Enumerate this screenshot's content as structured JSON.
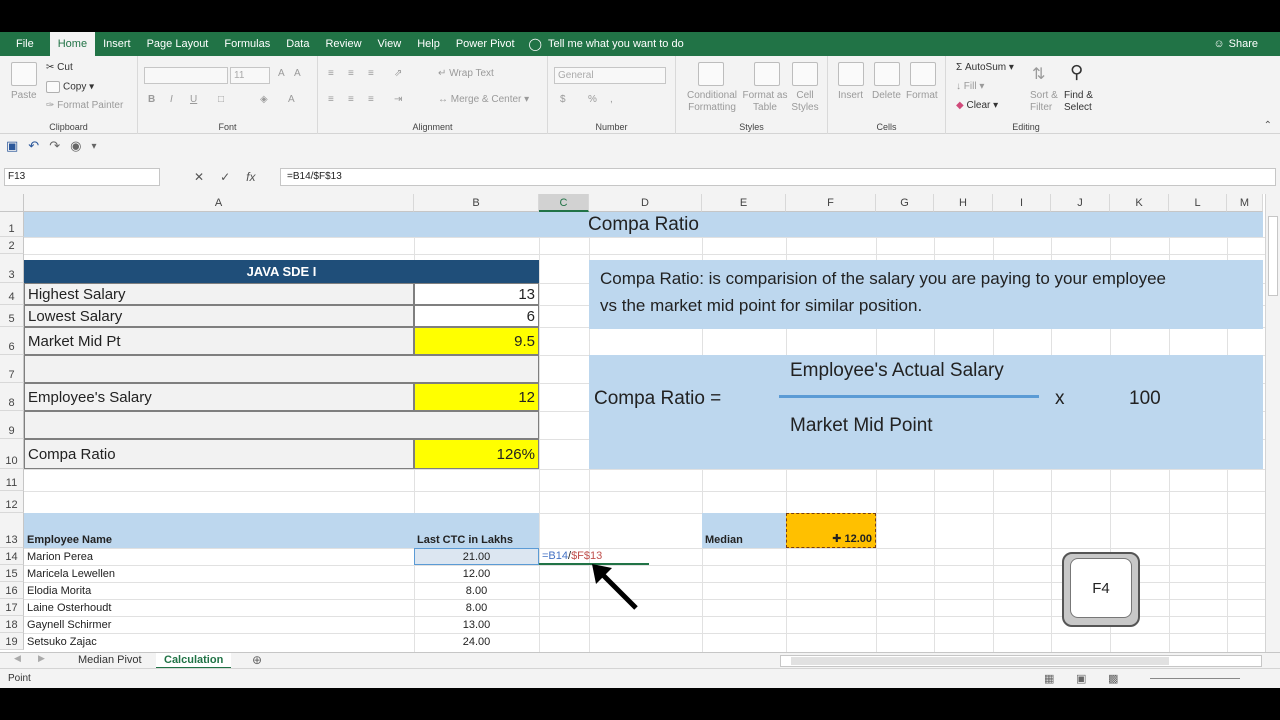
{
  "ribbon_tabs": [
    "File",
    "Home",
    "Insert",
    "Page Layout",
    "Formulas",
    "Data",
    "Review",
    "View",
    "Help",
    "Power Pivot"
  ],
  "active_tab": "Home",
  "tell_me": "Tell me what you want to do",
  "share": "Share",
  "ribbon": {
    "clipboard": {
      "paste": "Paste",
      "cut": "Cut",
      "copy": "Copy",
      "format_painter": "Format Painter",
      "label": "Clipboard"
    },
    "font": {
      "label": "Font",
      "size": "11",
      "bold": "B",
      "italic": "I",
      "underline": "U"
    },
    "alignment": {
      "wrap": "Wrap Text",
      "merge": "Merge & Center",
      "label": "Alignment"
    },
    "number": {
      "format": "General",
      "label": "Number",
      "currency": "$",
      "percent": "%",
      "comma": ","
    },
    "styles": {
      "conditional": "Conditional Formatting",
      "format_as_table": "Format as Table",
      "cell_styles": "Cell Styles",
      "label": "Styles"
    },
    "cells": {
      "insert": "Insert",
      "delete": "Delete",
      "format": "Format",
      "label": "Cells"
    },
    "editing": {
      "autosum": "AutoSum",
      "fill": "Fill",
      "clear": "Clear",
      "sort": "Sort & Filter",
      "find": "Find & Select",
      "label": "Editing"
    }
  },
  "name_box": "F13",
  "formula": "=B14/$F$13",
  "columns": [
    "A",
    "B",
    "C",
    "D",
    "E",
    "F",
    "G",
    "H",
    "I",
    "J",
    "K",
    "L",
    "M"
  ],
  "rows": [
    "1",
    "2",
    "3",
    "4",
    "5",
    "6",
    "7",
    "8",
    "9",
    "10",
    "11",
    "12",
    "13",
    "14",
    "15",
    "16",
    "17",
    "18",
    "19"
  ],
  "sheet": {
    "title": "Compa Ratio",
    "table_header": "JAVA SDE I",
    "labels": {
      "highest": "Highest Salary",
      "lowest": "Lowest Salary",
      "mid": "Market Mid Pt",
      "emp": "Employee's Salary",
      "ratio": "Compa Ratio"
    },
    "values": {
      "highest": "13",
      "lowest": "6",
      "mid": "9.5",
      "emp": "12",
      "ratio": "126%"
    },
    "definition_line1": "Compa Ratio: is comparision of the salary you are paying to your employee",
    "definition_line2": "vs the market mid point for similar position.",
    "formula_box": {
      "lhs": "Compa Ratio =",
      "numerator": "Employee's Actual Salary",
      "denominator": "Market Mid Point",
      "times": "x",
      "multiplier": "100"
    },
    "list_headers": {
      "name": "Employee Name",
      "ctc": "Last CTC in Lakhs"
    },
    "median_label": "Median",
    "median_value": "12.00",
    "editing_formula": {
      "ref1": "=B14",
      "slash": "/",
      "ref2": "$F$13"
    },
    "employees": [
      {
        "name": "Marion Perea",
        "ctc": "21.00"
      },
      {
        "name": "Maricela Lewellen",
        "ctc": "12.00"
      },
      {
        "name": "Elodia Morita",
        "ctc": "8.00"
      },
      {
        "name": "Laine Osterhoudt",
        "ctc": "8.00"
      },
      {
        "name": "Gaynell Schirmer",
        "ctc": "13.00"
      },
      {
        "name": "Setsuko Zajac",
        "ctc": "24.00"
      }
    ]
  },
  "sheet_tabs": [
    "Median Pivot",
    "Calculation"
  ],
  "active_sheet": "Calculation",
  "status": "Point",
  "key_label": "F4",
  "colors": {
    "excel_green": "#217346",
    "navy": "#1f4e79",
    "light_blue": "#bdd7ee",
    "yellow": "#ffff00",
    "gold": "#ffc000"
  }
}
